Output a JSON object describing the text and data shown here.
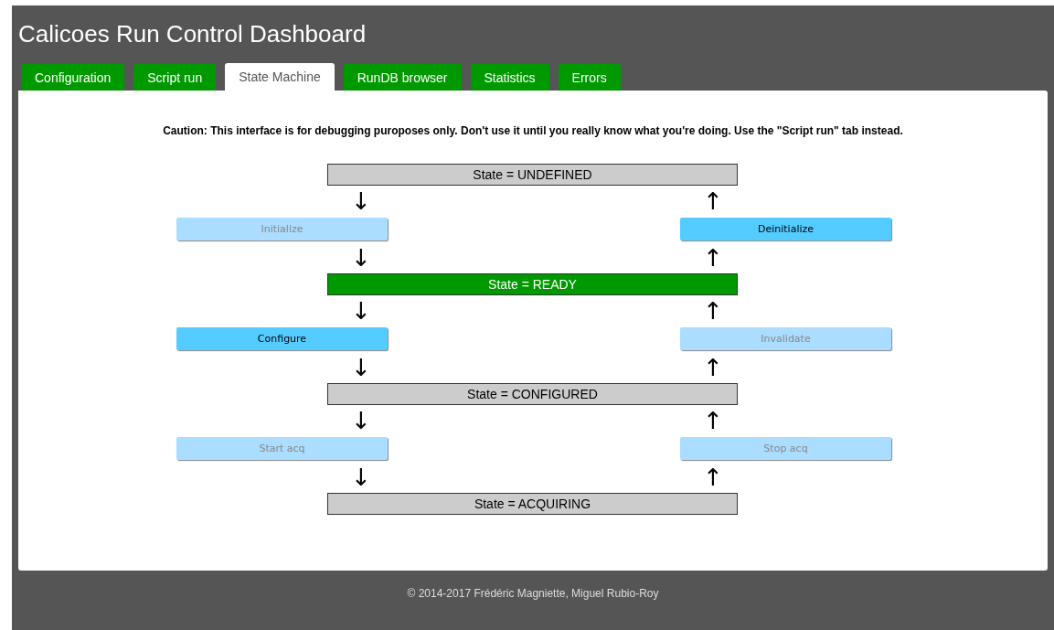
{
  "header": {
    "title": "Calicoes Run Control Dashboard"
  },
  "tabs": [
    {
      "label": "Configuration",
      "selected": false
    },
    {
      "label": "Script run",
      "selected": false
    },
    {
      "label": "State Machine",
      "selected": true
    },
    {
      "label": "RunDB browser",
      "selected": false
    },
    {
      "label": "Statistics",
      "selected": false
    },
    {
      "label": "Errors",
      "selected": false
    }
  ],
  "caution": "Caution: This interface is for debugging puroposes only. Don't use it until you really know what you're doing. Use the \"Script run\" tab instead.",
  "diagram": [
    {
      "kind": "state",
      "label": "State = UNDEFINED",
      "current": false
    },
    {
      "kind": "arrows",
      "left": "↓",
      "right": "↑"
    },
    {
      "kind": "actions",
      "left": {
        "label": "Initialize",
        "disabled": true
      },
      "right": {
        "label": "Deinitialize",
        "disabled": false
      }
    },
    {
      "kind": "arrows",
      "left": "↓",
      "right": "↑"
    },
    {
      "kind": "state",
      "label": "State = READY",
      "current": true
    },
    {
      "kind": "arrows",
      "left": "↓",
      "right": "↑"
    },
    {
      "kind": "actions",
      "left": {
        "label": "Configure",
        "disabled": false
      },
      "right": {
        "label": "Invalidate",
        "disabled": true
      }
    },
    {
      "kind": "arrows",
      "left": "↓",
      "right": "↑"
    },
    {
      "kind": "state",
      "label": "State = CONFIGURED",
      "current": false
    },
    {
      "kind": "arrows",
      "left": "↓",
      "right": "↑"
    },
    {
      "kind": "actions",
      "left": {
        "label": "Start acq",
        "disabled": true
      },
      "right": {
        "label": "Stop acq",
        "disabled": true
      }
    },
    {
      "kind": "arrows",
      "left": "↓",
      "right": "↑"
    },
    {
      "kind": "state",
      "label": "State = ACQUIRING",
      "current": false
    }
  ],
  "footer": "© 2014-2017 Frédéric Magniette, Miguel Rubio-Roy"
}
